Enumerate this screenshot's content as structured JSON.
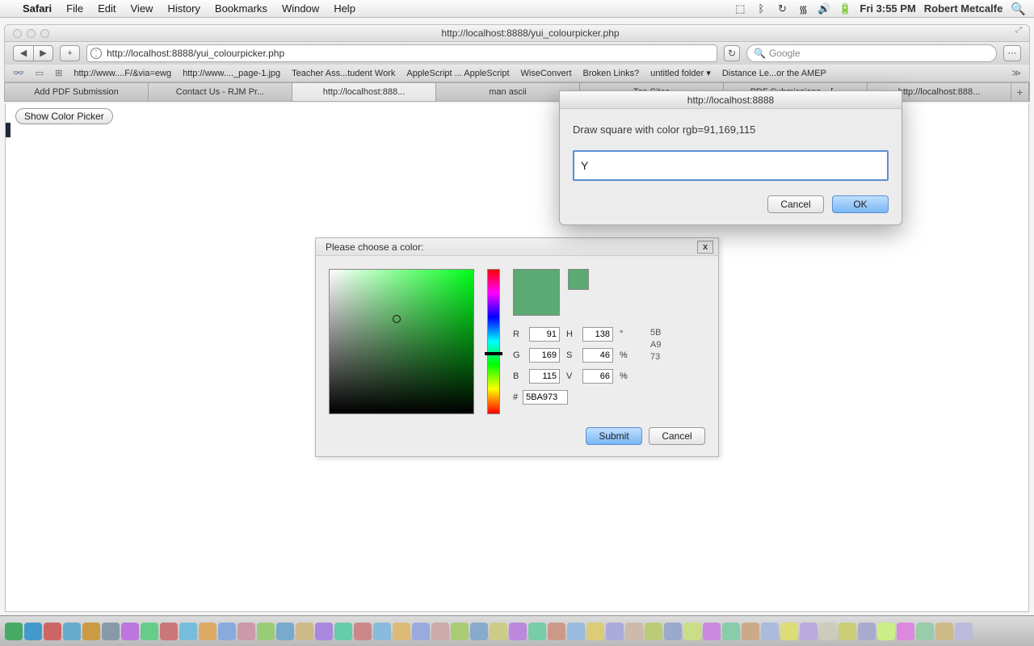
{
  "menubar": {
    "app": "Safari",
    "items": [
      "File",
      "Edit",
      "View",
      "History",
      "Bookmarks",
      "Window",
      "Help"
    ],
    "time": "Fri 3:55 PM",
    "user": "Robert Metcalfe"
  },
  "window": {
    "title": "http://localhost:8888/yui_colourpicker.php",
    "url": "http://localhost:8888/yui_colourpicker.php",
    "search_placeholder": "Google"
  },
  "bookmarks": [
    "http://www....F/&via=ewg",
    "http://www...._page-1.jpg",
    "Teacher Ass...tudent Work",
    "AppleScript ... AppleScript",
    "WiseConvert",
    "Broken Links?",
    "untitled folder ▾",
    "Distance Le...or the AMEP"
  ],
  "tabs": {
    "items": [
      "Add PDF Submission",
      "Contact Us - RJM Pr...",
      "http://localhost:888...",
      "man ascii",
      "Top Sites",
      "PDF Submissions – [...",
      "http://localhost:888..."
    ],
    "active_index": 2
  },
  "page": {
    "show_button": "Show Color Picker"
  },
  "dialog": {
    "host": "http://localhost:8888",
    "message": "Draw square with color rgb=91,169,115",
    "input_value": "Y",
    "cancel": "Cancel",
    "ok": "OK"
  },
  "picker": {
    "title": "Please choose a color:",
    "close": "x",
    "swatch_color": "#5BA973",
    "r_label": "R",
    "r": "91",
    "g_label": "G",
    "g": "169",
    "b_label": "B",
    "b": "115",
    "h_label": "H",
    "h": "138",
    "h_unit": "°",
    "s_label": "S",
    "s": "46",
    "s_unit": "%",
    "v_label": "V",
    "v": "66",
    "v_unit": "%",
    "hex_label": "#",
    "hex": "5BA973",
    "hex_bytes": [
      "5B",
      "A9",
      "73"
    ],
    "submit": "Submit",
    "cancel": "Cancel"
  },
  "colors": {
    "accent": "#5a8fd0",
    "swatch": "#5BA973"
  },
  "dock_colors": [
    "#4a6",
    "#49c",
    "#c66",
    "#6ac",
    "#c94",
    "#89a",
    "#b7d",
    "#6c8",
    "#c77",
    "#7bd",
    "#da6",
    "#8ad",
    "#c9a",
    "#9c7",
    "#7ac",
    "#cb8",
    "#a8d",
    "#6ca",
    "#c88",
    "#8bd",
    "#db7",
    "#9ad",
    "#caa",
    "#ac7",
    "#8ac",
    "#cc8",
    "#b8d",
    "#7ca",
    "#c98",
    "#9bd",
    "#dc7",
    "#aad",
    "#cba",
    "#bc7",
    "#9ac",
    "#cd8",
    "#c8d",
    "#8ca",
    "#ca8",
    "#abd",
    "#dd7",
    "#bad",
    "#ccb",
    "#cc7",
    "#aac",
    "#ce8",
    "#d8d",
    "#9ca",
    "#cb8",
    "#bbd"
  ]
}
